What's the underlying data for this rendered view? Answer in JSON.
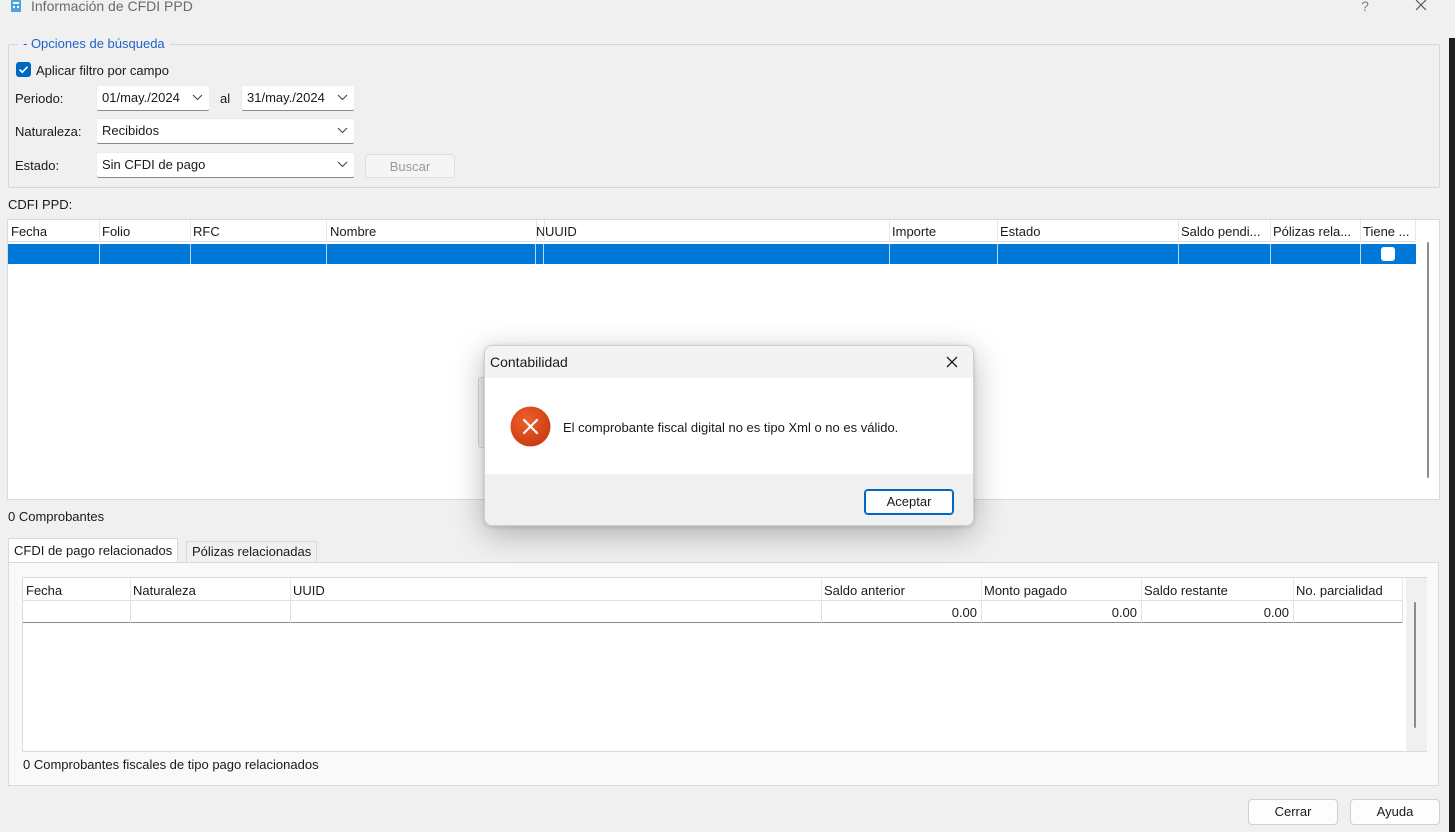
{
  "window": {
    "title": "Información de CFDI PPD",
    "help": "?"
  },
  "search": {
    "legend": "- Opciones de búsqueda",
    "filter_label": "Aplicar filtro por campo",
    "filter_checked": true,
    "period_label": "Periodo:",
    "period_from": "01/may./2024",
    "period_sep": "al",
    "period_to": "31/may./2024",
    "nature_label": "Naturaleza:",
    "nature_value": "Recibidos",
    "state_label": "Estado:",
    "state_value": "Sin CFDI de pago",
    "search_button": "Buscar"
  },
  "cfdi_grid": {
    "label": "CDFI PPD:",
    "columns": [
      "Fecha",
      "Folio",
      "RFC",
      "Nombre",
      "N",
      "UUID",
      "Importe",
      "Estado",
      "Saldo pendi...",
      "Pólizas rela...",
      "Tiene ..."
    ],
    "count_text": "0 Comprobantes"
  },
  "tabs": [
    {
      "label": "CFDI de pago relacionados",
      "active": true
    },
    {
      "label": "Pólizas relacionadas",
      "active": false
    }
  ],
  "payments_grid": {
    "columns": [
      "Fecha",
      "Naturaleza",
      "UUID",
      "Saldo anterior",
      "Monto pagado",
      "Saldo restante",
      "No. parcialidad"
    ],
    "row": {
      "saldo_anterior": "0.00",
      "monto_pagado": "0.00",
      "saldo_restante": "0.00"
    },
    "count_text": "0 Comprobantes fiscales de tipo pago relacionados"
  },
  "footer": {
    "close_button": "Cerrar",
    "help_button": "Ayuda"
  },
  "dialog": {
    "title": "Contabilidad",
    "message": "El comprobante fiscal digital no es tipo Xml o no es válido.",
    "ok_button": "Aceptar",
    "icon": "error-icon"
  },
  "colors": {
    "accent": "#0078d7",
    "checkbox": "#0067c0",
    "legend": "#1f63c7",
    "error": "#d4461c"
  }
}
